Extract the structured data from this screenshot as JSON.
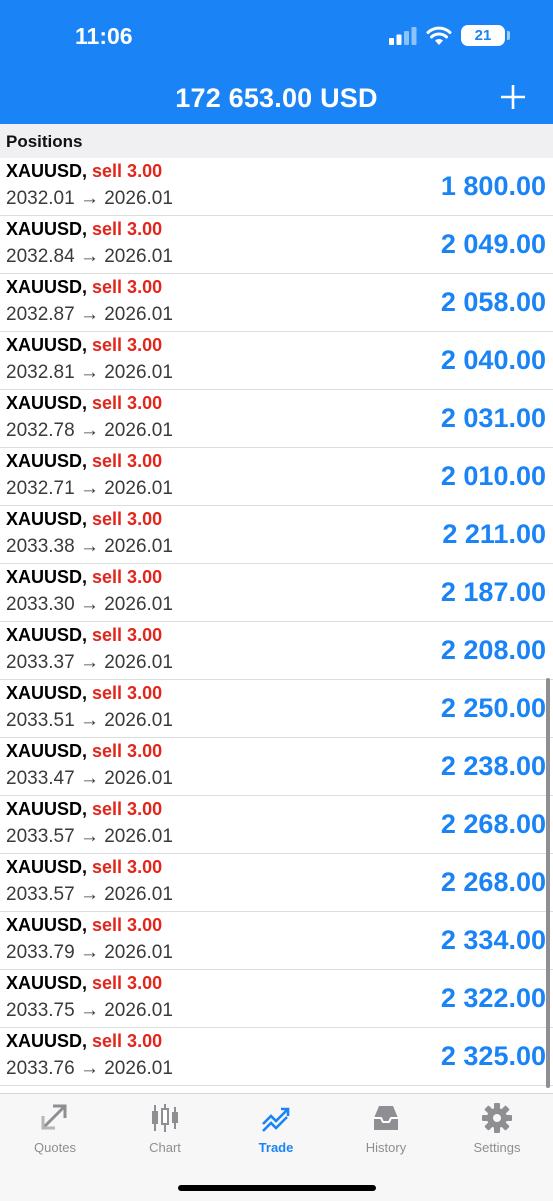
{
  "status_bar": {
    "time": "11:06",
    "battery": "21"
  },
  "header": {
    "balance": "172 653.00 USD"
  },
  "section": {
    "title": "Positions"
  },
  "positions": [
    {
      "symbol": "XAUUSD,",
      "side": "sell 3.00",
      "prices": "2032.01 → 2026.01",
      "profit": "1 800.00"
    },
    {
      "symbol": "XAUUSD,",
      "side": "sell 3.00",
      "prices": "2032.84 → 2026.01",
      "profit": "2 049.00"
    },
    {
      "symbol": "XAUUSD,",
      "side": "sell 3.00",
      "prices": "2032.87 → 2026.01",
      "profit": "2 058.00"
    },
    {
      "symbol": "XAUUSD,",
      "side": "sell 3.00",
      "prices": "2032.81 → 2026.01",
      "profit": "2 040.00"
    },
    {
      "symbol": "XAUUSD,",
      "side": "sell 3.00",
      "prices": "2032.78 → 2026.01",
      "profit": "2 031.00"
    },
    {
      "symbol": "XAUUSD,",
      "side": "sell 3.00",
      "prices": "2032.71 → 2026.01",
      "profit": "2 010.00"
    },
    {
      "symbol": "XAUUSD,",
      "side": "sell 3.00",
      "prices": "2033.38 → 2026.01",
      "profit": "2 211.00"
    },
    {
      "symbol": "XAUUSD,",
      "side": "sell 3.00",
      "prices": "2033.30 → 2026.01",
      "profit": "2 187.00"
    },
    {
      "symbol": "XAUUSD,",
      "side": "sell 3.00",
      "prices": "2033.37 → 2026.01",
      "profit": "2 208.00"
    },
    {
      "symbol": "XAUUSD,",
      "side": "sell 3.00",
      "prices": "2033.51 → 2026.01",
      "profit": "2 250.00"
    },
    {
      "symbol": "XAUUSD,",
      "side": "sell 3.00",
      "prices": "2033.47 → 2026.01",
      "profit": "2 238.00"
    },
    {
      "symbol": "XAUUSD,",
      "side": "sell 3.00",
      "prices": "2033.57 → 2026.01",
      "profit": "2 268.00"
    },
    {
      "symbol": "XAUUSD,",
      "side": "sell 3.00",
      "prices": "2033.57 → 2026.01",
      "profit": "2 268.00"
    },
    {
      "symbol": "XAUUSD,",
      "side": "sell 3.00",
      "prices": "2033.79 → 2026.01",
      "profit": "2 334.00"
    },
    {
      "symbol": "XAUUSD,",
      "side": "sell 3.00",
      "prices": "2033.75 → 2026.01",
      "profit": "2 322.00"
    },
    {
      "symbol": "XAUUSD,",
      "side": "sell 3.00",
      "prices": "2033.76 → 2026.01",
      "profit": "2 325.00"
    }
  ],
  "tabs": [
    {
      "label": "Quotes",
      "icon": "quotes-icon"
    },
    {
      "label": "Chart",
      "icon": "chart-icon"
    },
    {
      "label": "Trade",
      "icon": "trade-icon",
      "active": true
    },
    {
      "label": "History",
      "icon": "history-icon"
    },
    {
      "label": "Settings",
      "icon": "gear-icon"
    }
  ],
  "colors": {
    "accent": "#1a84f6",
    "sell": "#e3251b",
    "inactive": "#8e8e93"
  }
}
